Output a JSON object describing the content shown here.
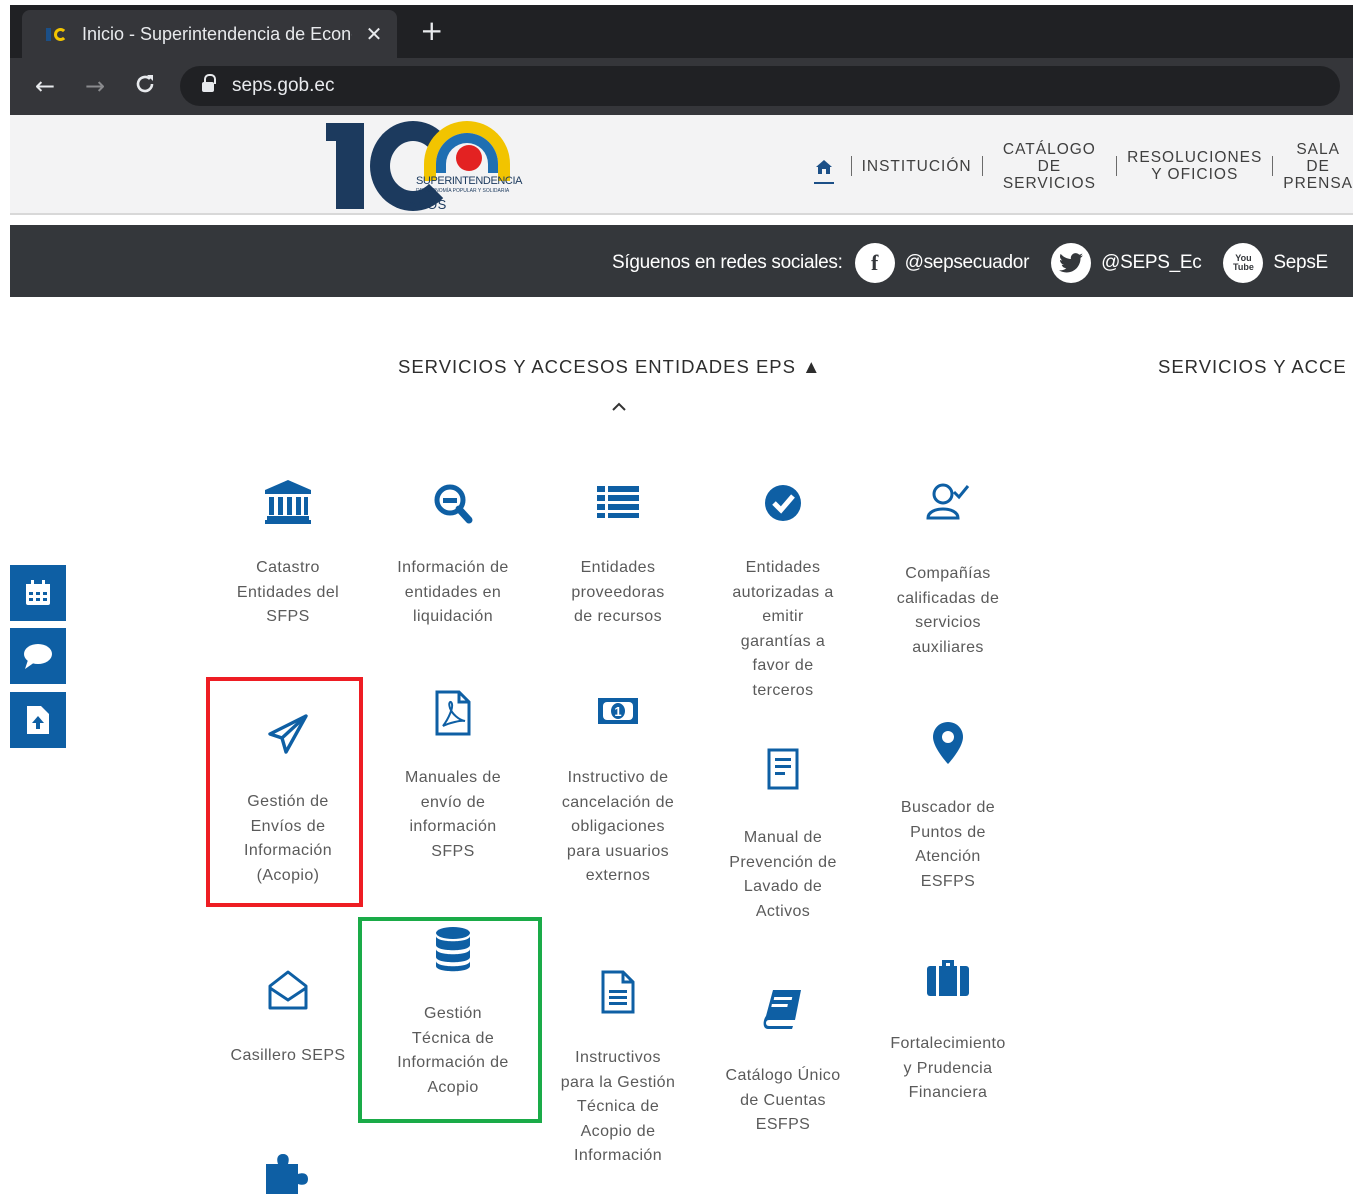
{
  "browser": {
    "tab_title": "Inicio - Superintendencia de Economía Popular y Solidaria",
    "tab_close": "✕",
    "new_tab": "+",
    "back": "←",
    "forward": "→",
    "reload": "C",
    "url": "seps.gob.ec"
  },
  "logo": {
    "line1": "SUPERINTENDENCIA",
    "line2": "DE ECONOMÍA POPULAR Y SOLIDARIA",
    "line3": "AÑOS"
  },
  "topnav": {
    "items": [
      {
        "label": "INSTITUCIÓN"
      },
      {
        "label": "CATÁLOGO\nDE SERVICIOS"
      },
      {
        "label": "RESOLUCIONES\nY OFICIOS"
      },
      {
        "label": "SALA DE\nPRENSA"
      }
    ]
  },
  "social": {
    "label": "Síguenos en redes sociales:",
    "facebook_glyph": "f",
    "facebook": "@sepsecuador",
    "twitter": "@SEPS_Ec",
    "youtube_glyph": "You\nTube",
    "youtube": "SepsE"
  },
  "sections": {
    "eps_title": "SERVICIOS Y ACCESOS ENTIDADES EPS ▲",
    "second_title": "SERVICIOS Y ACCE"
  },
  "tiles": [
    {
      "label": "Catastro\nEntidades del\nSFPS",
      "icon": "bank-icon"
    },
    {
      "label": "Información de\nentidades en\nliquidación",
      "icon": "search-minus-icon"
    },
    {
      "label": "Entidades\nproveedoras\nde recursos",
      "icon": "list-icon"
    },
    {
      "label": "Entidades\nautorizadas a\nemitir\ngarantías a\nfavor de\nterceros",
      "icon": "check-circle-icon"
    },
    {
      "label": "Compañías\ncalificadas de\nservicios\nauxiliares",
      "icon": "user-check-icon"
    },
    {
      "label": "Gestión de\nEnvíos de\nInformación\n(Acopio)",
      "icon": "paper-plane-icon"
    },
    {
      "label": "Manuales de\nenvío de\ninformación\nSFPS",
      "icon": "pdf-file-icon"
    },
    {
      "label": "Instructivo de\ncancelación de\nobligaciones\npara usuarios\nexternos",
      "icon": "money-bill-icon"
    },
    {
      "label": "Manual de\nPrevención de\nLavado de\nActivos",
      "icon": "document-icon"
    },
    {
      "label": "Buscador de\nPuntos de\nAtención\nESFPS",
      "icon": "map-pin-icon"
    },
    {
      "label": "Casillero SEPS",
      "icon": "envelope-open-icon"
    },
    {
      "label": "Gestión\nTécnica de\nInformación de\nAcopio",
      "icon": "database-icon"
    },
    {
      "label": "Instructivos\npara la Gestión\nTécnica de\nAcopio de\nInformación",
      "icon": "file-text-icon"
    },
    {
      "label": "Catálogo Único\nde Cuentas\nESFPS",
      "icon": "book-icon"
    },
    {
      "label": "Fortalecimiento\ny Prudencia\nFinanciera",
      "icon": "briefcase-icon"
    }
  ],
  "colors": {
    "brand_blue": "#0e5fa4",
    "highlight_red": "#ee1d23",
    "highlight_green": "#1aab48"
  }
}
